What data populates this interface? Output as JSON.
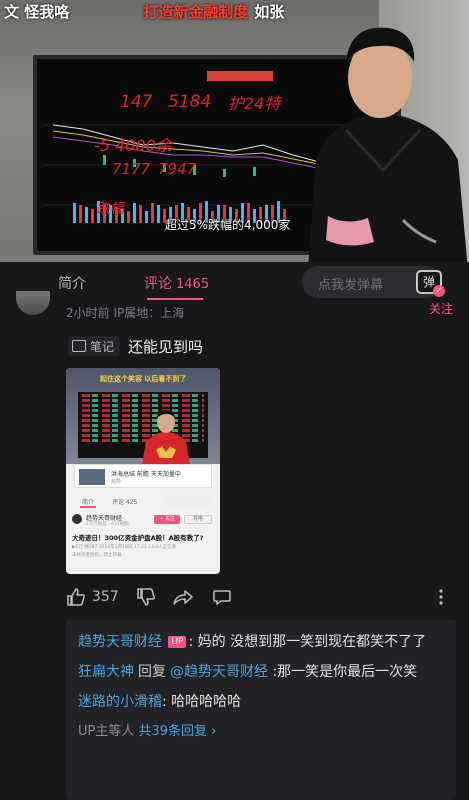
{
  "video": {
    "overlay_left": "文 怪我咯",
    "overlay_title": "打造新金融制度",
    "overlay_right": "如张",
    "subtitle": "超过5%跌幅的4,000家",
    "handwriting": [
      "147",
      "5184",
      "护24特",
      "-5 4000余",
      "7177",
      "7947",
      "跌幅"
    ]
  },
  "tabs": {
    "intro": "简介",
    "comments": "评论",
    "comments_count": "1465"
  },
  "danmu": {
    "placeholder": "点我发弹幕",
    "button_label": "弹"
  },
  "comment": {
    "meta": "2小时前 IP属地：上海",
    "reply_link": "关注",
    "note_tag": "笔记",
    "text": "还能见到吗",
    "likes": "357"
  },
  "thumbnail": {
    "caption": "起住这个笑容 以后看不到了",
    "card_title": "洪海总结 前瞻 天天加量中",
    "card_sub": "趋势",
    "tab_intro": "简介",
    "tab_comments": "评论 425",
    "username": "趋势天哥财经",
    "fans": "1万万粉丝 · 437视频",
    "follow": "+ 关注",
    "charge": "充电",
    "title": "大奇迹日！300亿资金护盘A股！A股有救了?",
    "stats": "▶6万 弹287 2024年1月18日 17:23 13.4人正在看",
    "stats2": "未经作者授权，禁止转载"
  },
  "replies": [
    {
      "user": "趋势天哥财经",
      "badge": "UP",
      "text": ": 妈的 没想到那一笑到现在都笑不了了"
    },
    {
      "user": "狂扁大神",
      "reply_word": "回复",
      "mention": "@趋势天哥财经",
      "text": " :那一笑是你最后一次笑"
    },
    {
      "user": "迷路的小滑稽",
      "text": ": 哈哈哈哈哈"
    }
  ],
  "replies_more": {
    "prefix": "UP主等人",
    "count": "共39条回复",
    "arrow": "›"
  },
  "colors": {
    "accent_pink": "#ff4f7e",
    "username_blue": "#4fa1d8",
    "background": "#17181a",
    "reply_box": "#222327"
  }
}
